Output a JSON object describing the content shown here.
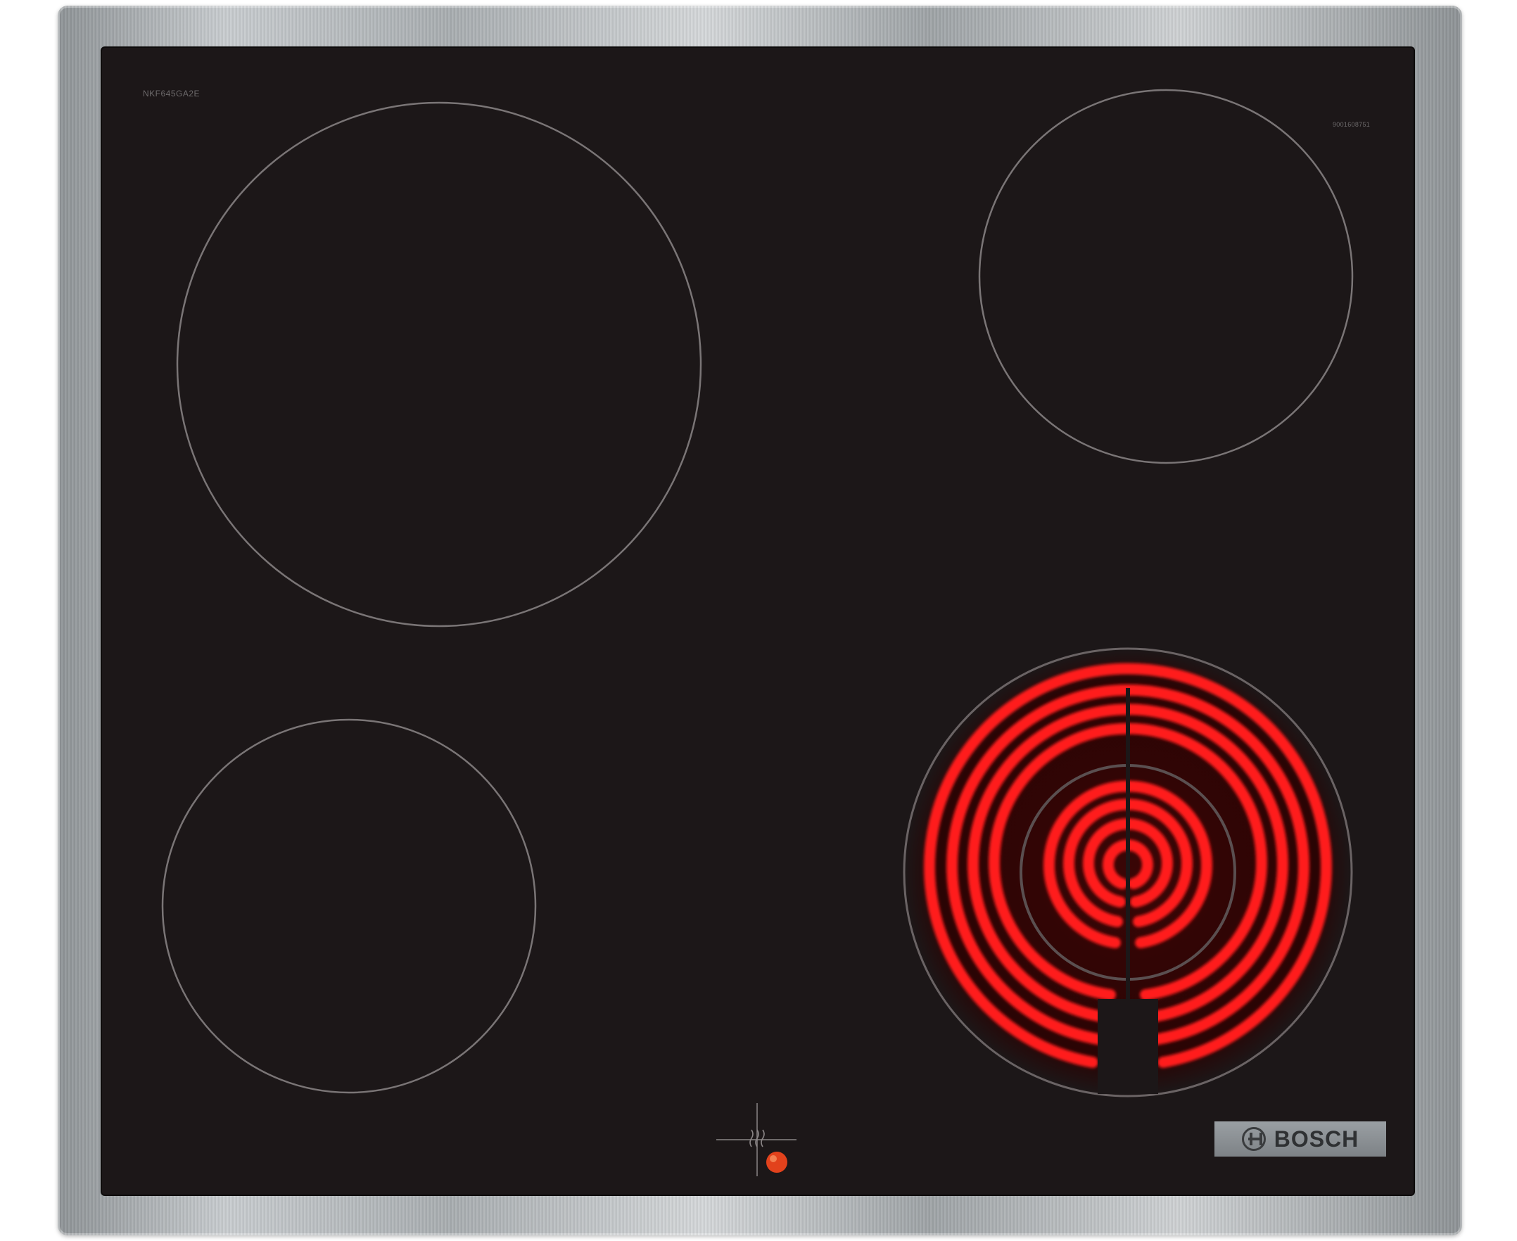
{
  "hob": {
    "model_number": "NKF645GA2E",
    "serial_number": "9001608751",
    "brand": "BOSCH",
    "zones": [
      {
        "name": "rear-left",
        "state": "off"
      },
      {
        "name": "rear-right",
        "state": "off"
      },
      {
        "name": "front-left",
        "state": "off"
      },
      {
        "name": "front-right",
        "state": "on"
      }
    ],
    "residual_heat_indicator": "on"
  },
  "colors": {
    "frame": "#b5babd",
    "glass": "#1c1718",
    "zone_outline": "#7a7576",
    "heating_element": "#ff1a1a",
    "indicator": "#e2421c"
  },
  "icons": {
    "brand": "bosch-logo-icon",
    "heat": "residual-heat-icon",
    "indicator": "indicator-light-icon"
  }
}
